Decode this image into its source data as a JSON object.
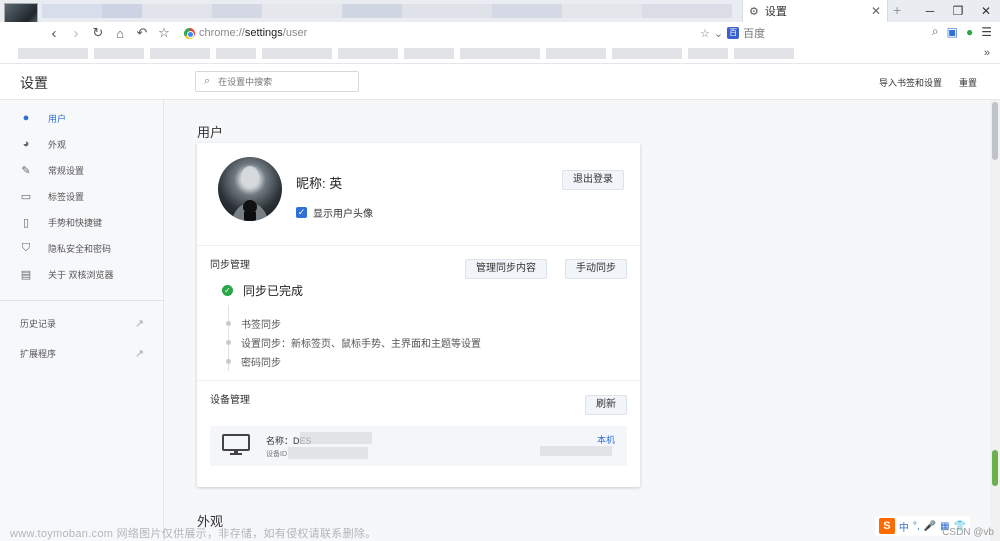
{
  "browser": {
    "active_tab_title": "设置",
    "url_prefix": "chrome://",
    "url_host": "settings",
    "url_path": "/user",
    "search_engine_label": "百度",
    "more_bookmarks": "»"
  },
  "header": {
    "title": "设置",
    "search_placeholder": "在设置中搜索",
    "import_label": "导入书签和设置",
    "reset_label": "重置"
  },
  "sidebar": {
    "items": [
      {
        "label": "用户",
        "icon": "person-icon",
        "active": true
      },
      {
        "label": "外观",
        "icon": "palette-icon",
        "active": false
      },
      {
        "label": "常规设置",
        "icon": "wrench-icon",
        "active": false
      },
      {
        "label": "标签设置",
        "icon": "tab-icon",
        "active": false
      },
      {
        "label": "手势和快捷键",
        "icon": "mouse-icon",
        "active": false
      },
      {
        "label": "隐私安全和密码",
        "icon": "shield-icon",
        "active": false
      },
      {
        "label": "关于 双核浏览器",
        "icon": "info-doc-icon",
        "active": false
      }
    ],
    "links": [
      {
        "label": "历史记录"
      },
      {
        "label": "扩展程序"
      }
    ]
  },
  "main": {
    "section_user": "用户",
    "nickname_label": "昵称:",
    "nickname_value": "英",
    "show_avatar_label": "显示用户头像",
    "show_avatar_checked": true,
    "logout_button": "退出登录",
    "sync": {
      "title": "同步管理",
      "manage_button": "管理同步内容",
      "manual_button": "手动同步",
      "status": "同步已完成",
      "items": [
        "书签同步",
        "设置同步：新标签页、鼠标手势、主界面和主题等设置",
        "密码同步"
      ]
    },
    "devices": {
      "title": "设备管理",
      "refresh_button": "刷新",
      "name_label": "名称：DES",
      "id_label": "设备ID",
      "this_device": "本机"
    },
    "section_appearance": "外观"
  },
  "overlay": {
    "watermark": "www.toymoban.com 网络图片仅供展示，非存储，如有侵权请联系删除。",
    "csdn": "CSDN @vb"
  },
  "colors": {
    "accent": "#2f6fd6",
    "success": "#29a745",
    "sidebar_bg": "#f7f8fa",
    "main_bg": "#f6f7f9"
  }
}
